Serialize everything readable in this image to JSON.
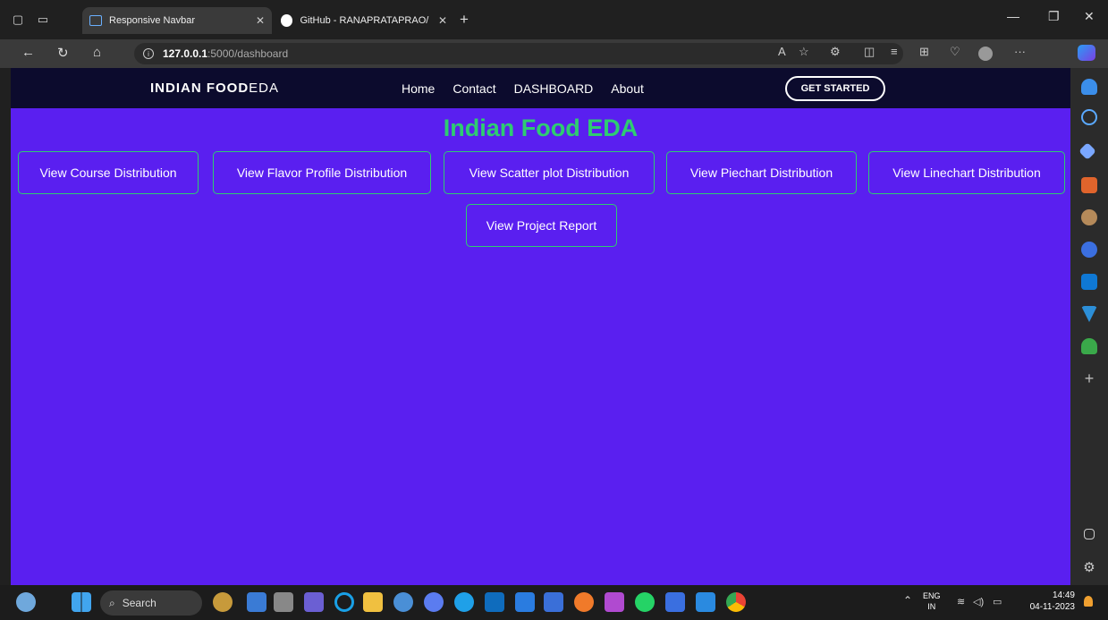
{
  "browser": {
    "tabs": [
      {
        "label": "Responsive Navbar",
        "active": true
      },
      {
        "label": "GitHub - RANAPRATAPRAO/Data",
        "active": false
      }
    ],
    "url_host": "127.0.0.1",
    "url_path": ":5000/dashboard"
  },
  "site": {
    "logo_bold": "INDIAN FOOD",
    "logo_light": "EDA",
    "nav": [
      "Home",
      "Contact",
      "DASHBOARD",
      "About"
    ],
    "cta": "GET STARTED",
    "heading": "Indian Food EDA",
    "buttons": [
      "View Course Distribution",
      "View Flavor Profile Distribution",
      "View Scatter plot Distribution",
      "View Piechart Distribution",
      "View Linechart Distribution",
      "View Project Report"
    ]
  },
  "taskbar": {
    "search_label": "Search",
    "lang_top": "ENG",
    "lang_bottom": "IN",
    "time": "14:49",
    "date": "04-11-2023"
  },
  "colors": {
    "page_bg": "#5a1ff0",
    "nav_bg": "#0c0b2d",
    "accent": "#2ecc71"
  }
}
